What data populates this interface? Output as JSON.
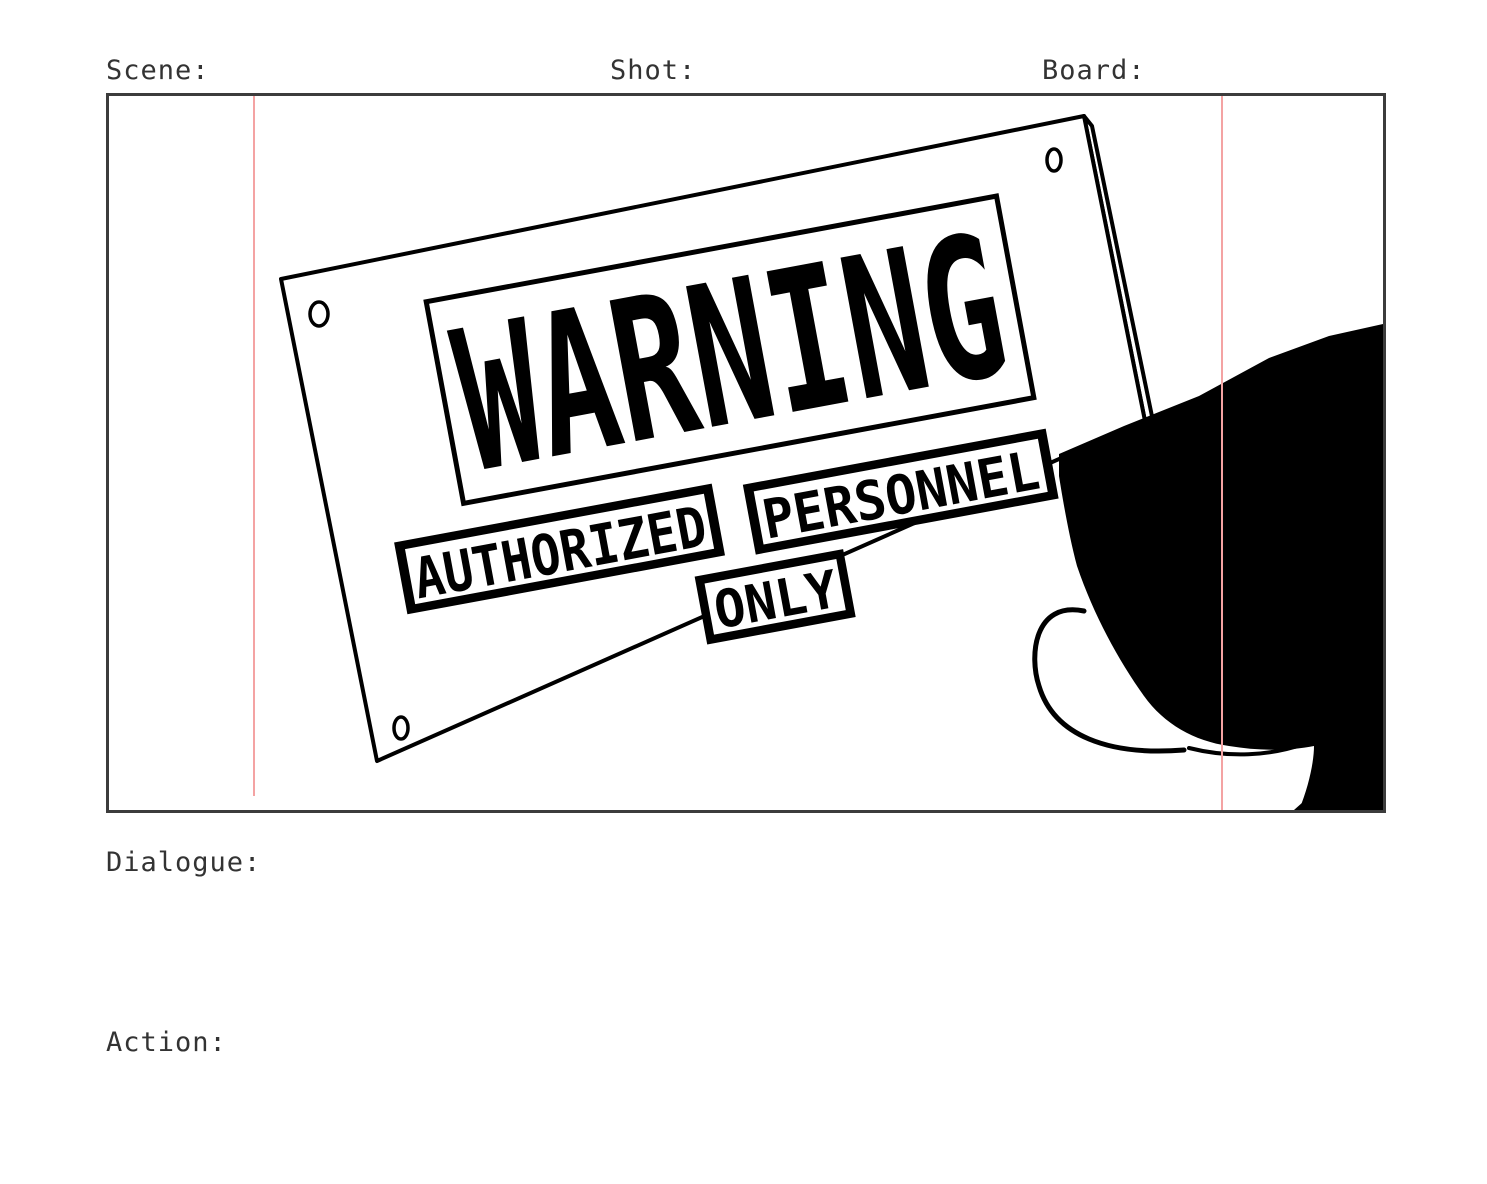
{
  "labels": {
    "scene": "Scene:",
    "shot": "Shot:",
    "board": "Board:",
    "dialogue": "Dialogue:",
    "action": "Action:"
  },
  "sign": {
    "title": "WARNING",
    "line1_word1": "AUTHORIZED",
    "line1_word2": "PERSONNEL",
    "line2": "ONLY"
  },
  "colors": {
    "ink": "#000000",
    "frame": "#3c3c3c",
    "label_text": "#333333",
    "safe_area_guide": "#f4a3a3"
  }
}
